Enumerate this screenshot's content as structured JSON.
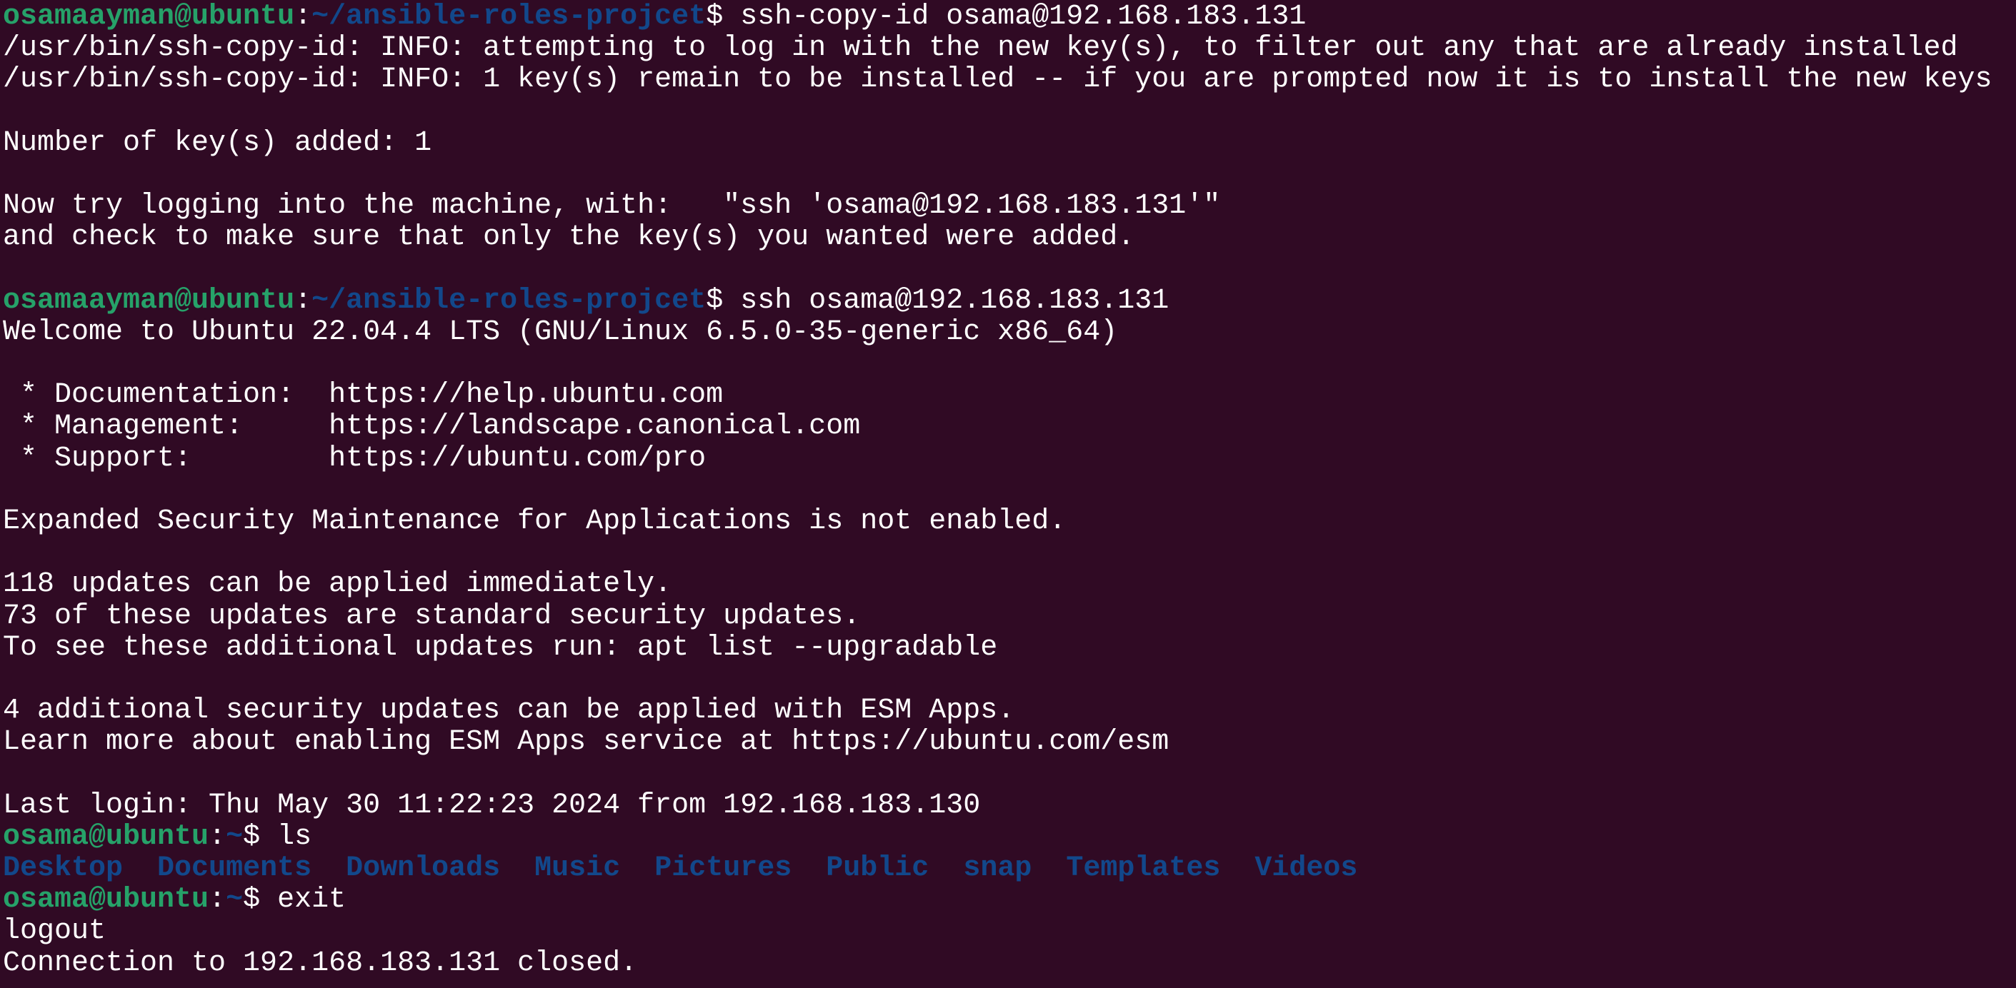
{
  "colors": {
    "background": "#300a24",
    "prompt_user": "#26a269",
    "prompt_path": "#12488b",
    "text": "#ffffff"
  },
  "terminal": {
    "lines": [
      [
        {
          "t": "osamaayman@ubuntu",
          "c": "user"
        },
        {
          "t": ":",
          "c": "plain"
        },
        {
          "t": "~/ansible-roles-projcet",
          "c": "path"
        },
        {
          "t": "$ ssh-copy-id osama@192.168.183.131",
          "c": "plain"
        }
      ],
      [
        {
          "t": "/usr/bin/ssh-copy-id: INFO: attempting to log in with the new key(s), to filter out any that are already installed",
          "c": "plain"
        }
      ],
      [
        {
          "t": "/usr/bin/ssh-copy-id: INFO: 1 key(s) remain to be installed -- if you are prompted now it is to install the new keys",
          "c": "plain"
        }
      ],
      [],
      [
        {
          "t": "Number of key(s) added: 1",
          "c": "plain"
        }
      ],
      [],
      [
        {
          "t": "Now try logging into the machine, with:   \"ssh 'osama@192.168.183.131'\"",
          "c": "plain"
        }
      ],
      [
        {
          "t": "and check to make sure that only the key(s) you wanted were added.",
          "c": "plain"
        }
      ],
      [],
      [
        {
          "t": "osamaayman@ubuntu",
          "c": "user"
        },
        {
          "t": ":",
          "c": "plain"
        },
        {
          "t": "~/ansible-roles-projcet",
          "c": "path"
        },
        {
          "t": "$ ssh osama@192.168.183.131",
          "c": "plain"
        }
      ],
      [
        {
          "t": "Welcome to Ubuntu 22.04.4 LTS (GNU/Linux 6.5.0-35-generic x86_64)",
          "c": "plain"
        }
      ],
      [],
      [
        {
          "t": " * Documentation:  https://help.ubuntu.com",
          "c": "plain"
        }
      ],
      [
        {
          "t": " * Management:     https://landscape.canonical.com",
          "c": "plain"
        }
      ],
      [
        {
          "t": " * Support:        https://ubuntu.com/pro",
          "c": "plain"
        }
      ],
      [],
      [
        {
          "t": "Expanded Security Maintenance for Applications is not enabled.",
          "c": "plain"
        }
      ],
      [],
      [
        {
          "t": "118 updates can be applied immediately.",
          "c": "plain"
        }
      ],
      [
        {
          "t": "73 of these updates are standard security updates.",
          "c": "plain"
        }
      ],
      [
        {
          "t": "To see these additional updates run: apt list --upgradable",
          "c": "plain"
        }
      ],
      [],
      [
        {
          "t": "4 additional security updates can be applied with ESM Apps.",
          "c": "plain"
        }
      ],
      [
        {
          "t": "Learn more about enabling ESM Apps service at https://ubuntu.com/esm",
          "c": "plain"
        }
      ],
      [],
      [
        {
          "t": "Last login: Thu May 30 11:22:23 2024 from 192.168.183.130",
          "c": "plain"
        }
      ],
      [
        {
          "t": "osama@ubuntu",
          "c": "user"
        },
        {
          "t": ":",
          "c": "plain"
        },
        {
          "t": "~",
          "c": "path"
        },
        {
          "t": "$ ls",
          "c": "plain"
        }
      ],
      [
        {
          "t": "Desktop",
          "c": "dir"
        },
        {
          "t": "  ",
          "c": "plain"
        },
        {
          "t": "Documents",
          "c": "dir"
        },
        {
          "t": "  ",
          "c": "plain"
        },
        {
          "t": "Downloads",
          "c": "dir"
        },
        {
          "t": "  ",
          "c": "plain"
        },
        {
          "t": "Music",
          "c": "dir"
        },
        {
          "t": "  ",
          "c": "plain"
        },
        {
          "t": "Pictures",
          "c": "dir"
        },
        {
          "t": "  ",
          "c": "plain"
        },
        {
          "t": "Public",
          "c": "dir"
        },
        {
          "t": "  ",
          "c": "plain"
        },
        {
          "t": "snap",
          "c": "dir"
        },
        {
          "t": "  ",
          "c": "plain"
        },
        {
          "t": "Templates",
          "c": "dir"
        },
        {
          "t": "  ",
          "c": "plain"
        },
        {
          "t": "Videos",
          "c": "dir"
        }
      ],
      [
        {
          "t": "osama@ubuntu",
          "c": "user"
        },
        {
          "t": ":",
          "c": "plain"
        },
        {
          "t": "~",
          "c": "path"
        },
        {
          "t": "$ exit",
          "c": "plain"
        }
      ],
      [
        {
          "t": "logout",
          "c": "plain"
        }
      ],
      [
        {
          "t": "Connection to 192.168.183.131 closed.",
          "c": "plain"
        }
      ]
    ]
  }
}
